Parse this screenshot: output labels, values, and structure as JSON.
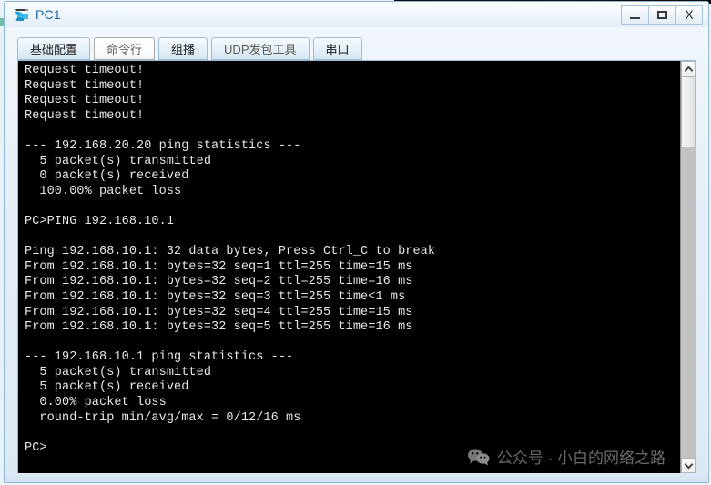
{
  "window": {
    "title": "PC1",
    "icon": "pc-device-icon",
    "buttons": {
      "minimize": "–",
      "maximize": "□",
      "close": "X"
    }
  },
  "tabs": [
    {
      "label": "基础配置",
      "name": "tab-basic-config",
      "active": false
    },
    {
      "label": "命令行",
      "name": "tab-command-line",
      "active": true
    },
    {
      "label": "组播",
      "name": "tab-multicast",
      "active": false
    },
    {
      "label": "UDP发包工具",
      "name": "tab-udp-tool",
      "active": false
    },
    {
      "label": "串口",
      "name": "tab-serial-port",
      "active": false
    }
  ],
  "terminal": {
    "background": "#000000",
    "foreground": "#e8e8e8",
    "lines": [
      "Request timeout!",
      "Request timeout!",
      "Request timeout!",
      "Request timeout!",
      "",
      "--- 192.168.20.20 ping statistics ---",
      "  5 packet(s) transmitted",
      "  0 packet(s) received",
      "  100.00% packet loss",
      "",
      "PC>PING 192.168.10.1",
      "",
      "Ping 192.168.10.1: 32 data bytes, Press Ctrl_C to break",
      "From 192.168.10.1: bytes=32 seq=1 ttl=255 time=15 ms",
      "From 192.168.10.1: bytes=32 seq=2 ttl=255 time=16 ms",
      "From 192.168.10.1: bytes=32 seq=3 ttl=255 time<1 ms",
      "From 192.168.10.1: bytes=32 seq=4 ttl=255 time=15 ms",
      "From 192.168.10.1: bytes=32 seq=5 ttl=255 time=16 ms",
      "",
      "--- 192.168.10.1 ping statistics ---",
      "  5 packet(s) transmitted",
      "  5 packet(s) received",
      "  0.00% packet loss",
      "  round-trip min/avg/max = 0/12/16 ms",
      "",
      "PC>"
    ]
  },
  "watermark": {
    "icon": "wechat-icon",
    "text": "公众号 · 小白的网络之路"
  },
  "scrollbar": {
    "up_arrow": "chevron-up-icon",
    "down_arrow": "chevron-down-icon",
    "thumb_position_percent": 0
  }
}
